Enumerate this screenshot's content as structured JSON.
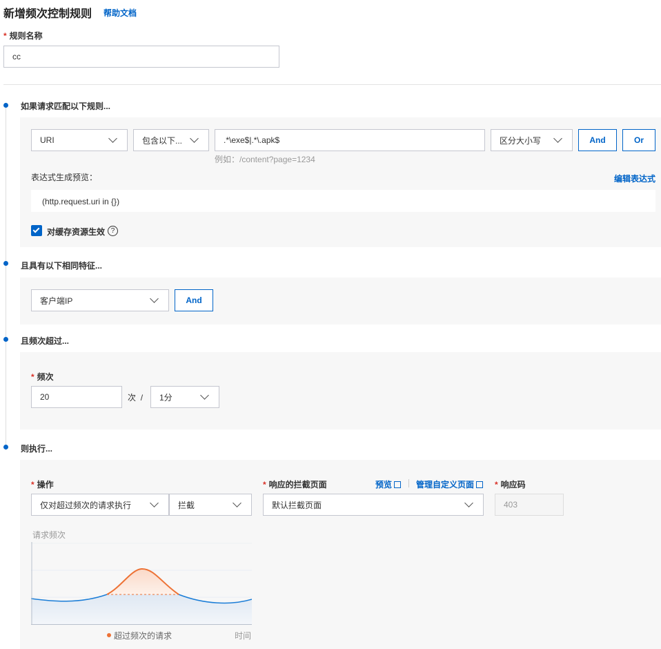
{
  "header": {
    "title": "新增频次控制规则",
    "help_link": "帮助文档"
  },
  "rule_name": {
    "label": "规则名称",
    "value": "cc"
  },
  "section1": {
    "title": "如果请求匹配以下规则...",
    "field": "URI",
    "operator": "包含以下...",
    "value": ".*\\exe$|.*\\.apk$",
    "hint": "例如：/content?page=1234",
    "case": "区分大小写",
    "and_label": "And",
    "or_label": "Or",
    "preview_label": "表达式生成预览：",
    "edit_link": "编辑表达式",
    "preview_expr": "(http.request.uri in {})",
    "cache_label": "对缓存资源生效",
    "cache_checked": true
  },
  "section2": {
    "title": "且具有以下相同特征...",
    "feature": "客户端IP",
    "and_label": "And"
  },
  "section3": {
    "title": "且频次超过...",
    "freq_label": "频次",
    "freq_value": "20",
    "unit_text": "次",
    "slash": "/",
    "period": "1分"
  },
  "section4": {
    "title": "则执行...",
    "action_label": "操作",
    "action_scope": "仅对超过频次的请求执行",
    "action": "拦截",
    "page_label": "响应的拦截页面",
    "preview_link": "预览",
    "manage_link": "管理自定义页面",
    "page_value": "默认拦截页面",
    "code_label": "响应码",
    "code_value": "403"
  },
  "chart": {
    "ylabel": "请求频次",
    "xlabel": "时间",
    "legend": "超过频次的请求",
    "colors": {
      "normal": "#1a7dd7",
      "exceed": "#ed7235"
    }
  },
  "colors": {
    "primary": "#0064c8",
    "required": "#d93026"
  }
}
